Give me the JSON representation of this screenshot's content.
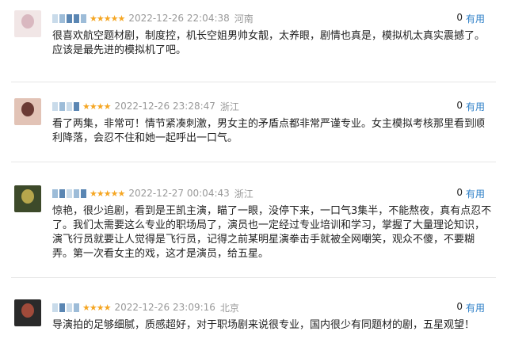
{
  "reviews": [
    {
      "stars": "★★★★★",
      "time": "2022-12-26 22:04:38",
      "location": "河南",
      "useful_count": "0",
      "useful_label": "有用",
      "content": "很喜欢航空题材剧，制度控，机长空姐男帅女靓，太养眼，剧情也真是，模拟机太真实震撼了。应该是最先进的模拟机了吧。",
      "avatar_colors": [
        "#d9b8c0",
        "#f1e6e6"
      ]
    },
    {
      "stars": "★★★★",
      "time": "2022-12-26 23:28:47",
      "location": "浙江",
      "useful_count": "0",
      "useful_label": "有用",
      "content": "看了两集，非常可！情节紧凑刺激，男女主的矛盾点都非常严谨专业。女主模拟考核那里看到顺利降落，会忍不住和她一起呼出一口气。",
      "avatar_colors": [
        "#6b3a34",
        "#e2c3b6"
      ]
    },
    {
      "stars": "★★★★★",
      "time": "2022-12-27 00:04:43",
      "location": "浙江",
      "useful_count": "0",
      "useful_label": "有用",
      "content": "惊艳，很少追剧，看到是王凯主演，瞄了一眼，没停下来，一口气3集半，不能熬夜，真有点忍不了。我们太需要这么专业的职场局了，演员也一定经过专业培训和学习，掌握了大量理论知识，演飞行员就要让人觉得是飞行员，记得之前某明星演拳击手就被全网嘲笑，观众不傻，不要糊弄。第一次看女主的戏，这才是演员，给五星。",
      "avatar_colors": [
        "#b7a64c",
        "#3d4a2a"
      ]
    },
    {
      "stars": "★★★★",
      "time": "2022-12-26 23:09:16",
      "location": "北京",
      "useful_count": "0",
      "useful_label": "有用",
      "content": "导演拍的足够细腻，质感超好，对于职场剧来说很专业，国内很少有同题材的剧，五星观望！",
      "avatar_colors": [
        "#a04a3a",
        "#2a2a2a"
      ]
    }
  ]
}
